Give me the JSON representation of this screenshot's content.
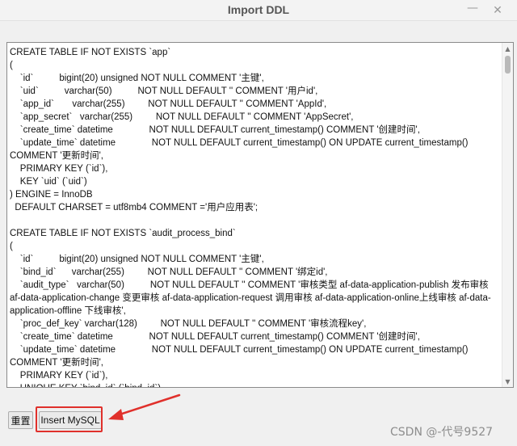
{
  "window": {
    "title": "Import DDL",
    "minimize_glyph": "—",
    "close_glyph": "✕"
  },
  "ddl": {
    "text": "CREATE TABLE IF NOT EXISTS `app`\n(\n    `id`          bigint(20) unsigned NOT NULL COMMENT '主键',\n    `uid`          varchar(50)          NOT NULL DEFAULT '' COMMENT '用户id',\n    `app_id`       varchar(255)         NOT NULL DEFAULT '' COMMENT 'AppId',\n    `app_secret`   varchar(255)         NOT NULL DEFAULT '' COMMENT 'AppSecret',\n    `create_time` datetime              NOT NULL DEFAULT current_timestamp() COMMENT '创建时间',\n    `update_time` datetime              NOT NULL DEFAULT current_timestamp() ON UPDATE current_timestamp()\nCOMMENT '更新时间',\n    PRIMARY KEY (`id`),\n    KEY `uid` (`uid`)\n) ENGINE = InnoDB\n  DEFAULT CHARSET = utf8mb4 COMMENT ='用户应用表';\n\nCREATE TABLE IF NOT EXISTS `audit_process_bind`\n(\n    `id`          bigint(20) unsigned NOT NULL COMMENT '主键',\n    `bind_id`      varchar(255)         NOT NULL DEFAULT '' COMMENT '绑定id',\n    `audit_type`   varchar(50)          NOT NULL DEFAULT '' COMMENT '审核类型 af-data-application-publish 发布审核 af-data-application-change 变更审核 af-data-application-request 调用审核 af-data-application-online上线审核 af-data-application-offline 下线审核',\n    `proc_def_key` varchar(128)         NOT NULL DEFAULT '' COMMENT '审核流程key',\n    `create_time` datetime              NOT NULL DEFAULT current_timestamp() COMMENT '创建时间',\n    `update_time` datetime              NOT NULL DEFAULT current_timestamp() ON UPDATE current_timestamp()\nCOMMENT '更新时间',\n    PRIMARY KEY (`id`),\n    UNIQUE KEY `bind_id` (`bind_id`)"
  },
  "buttons": {
    "reset_label": "重置",
    "insert_label": "Insert MySQL"
  },
  "annotation": {
    "highlight_color": "#e0302b"
  },
  "watermark": {
    "text": "CSDN @-代号9527"
  }
}
